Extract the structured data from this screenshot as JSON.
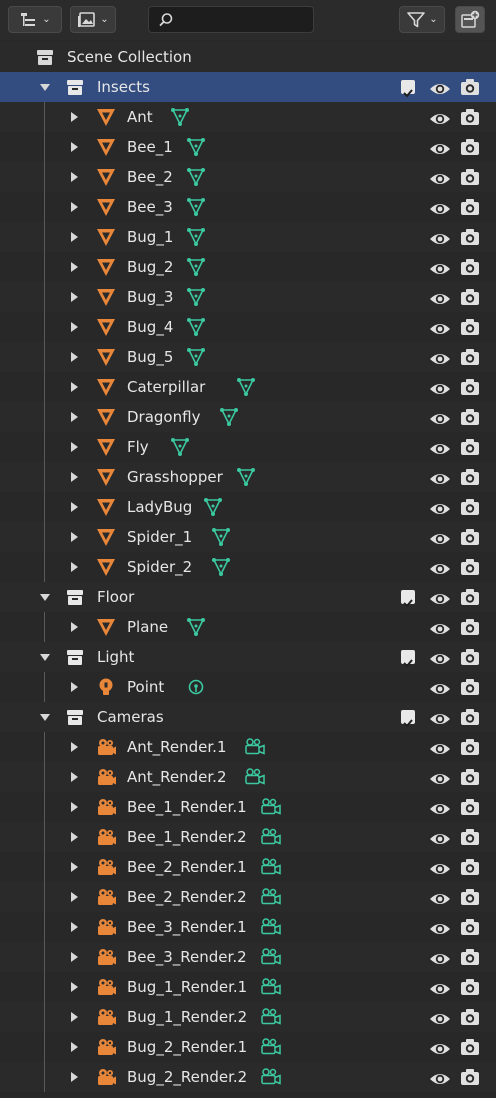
{
  "header": {
    "search_placeholder": "",
    "display_mode_icon": "outliner-view-icon",
    "filter_icon": "funnel-icon",
    "new_collection_icon": "new-collection-icon"
  },
  "colors": {
    "selected_row": "#334d80",
    "object_icon": "#e8873a",
    "data_icon": "#3bc9a0",
    "background": "#282828"
  },
  "tree": {
    "rows": [
      {
        "label": "Scene Collection",
        "type": "scene",
        "depth": 0,
        "expander": "none",
        "checkbox": false,
        "eye": false,
        "camera": false
      },
      {
        "label": "Insects",
        "type": "collection",
        "depth": 1,
        "expander": "down",
        "checkbox": true,
        "eye": true,
        "camera": true,
        "selected": true
      },
      {
        "label": "Ant",
        "type": "mesh",
        "depth": 2,
        "expander": "right",
        "checkbox": false,
        "eye": true,
        "camera": true
      },
      {
        "label": "Bee_1",
        "type": "mesh",
        "depth": 2,
        "expander": "right",
        "checkbox": false,
        "eye": true,
        "camera": true
      },
      {
        "label": "Bee_2",
        "type": "mesh",
        "depth": 2,
        "expander": "right",
        "checkbox": false,
        "eye": true,
        "camera": true
      },
      {
        "label": "Bee_3",
        "type": "mesh",
        "depth": 2,
        "expander": "right",
        "checkbox": false,
        "eye": true,
        "camera": true
      },
      {
        "label": "Bug_1",
        "type": "mesh",
        "depth": 2,
        "expander": "right",
        "checkbox": false,
        "eye": true,
        "camera": true
      },
      {
        "label": "Bug_2",
        "type": "mesh",
        "depth": 2,
        "expander": "right",
        "checkbox": false,
        "eye": true,
        "camera": true
      },
      {
        "label": "Bug_3",
        "type": "mesh",
        "depth": 2,
        "expander": "right",
        "checkbox": false,
        "eye": true,
        "camera": true
      },
      {
        "label": "Bug_4",
        "type": "mesh",
        "depth": 2,
        "expander": "right",
        "checkbox": false,
        "eye": true,
        "camera": true
      },
      {
        "label": "Bug_5",
        "type": "mesh",
        "depth": 2,
        "expander": "right",
        "checkbox": false,
        "eye": true,
        "camera": true
      },
      {
        "label": "Caterpillar",
        "type": "mesh",
        "depth": 2,
        "expander": "right",
        "checkbox": false,
        "eye": true,
        "camera": true
      },
      {
        "label": "Dragonfly",
        "type": "mesh",
        "depth": 2,
        "expander": "right",
        "checkbox": false,
        "eye": true,
        "camera": true
      },
      {
        "label": "Fly",
        "type": "mesh",
        "depth": 2,
        "expander": "right",
        "checkbox": false,
        "eye": true,
        "camera": true
      },
      {
        "label": "Grasshopper",
        "type": "mesh",
        "depth": 2,
        "expander": "right",
        "checkbox": false,
        "eye": true,
        "camera": true
      },
      {
        "label": "LadyBug",
        "type": "mesh",
        "depth": 2,
        "expander": "right",
        "checkbox": false,
        "eye": true,
        "camera": true
      },
      {
        "label": "Spider_1",
        "type": "mesh",
        "depth": 2,
        "expander": "right",
        "checkbox": false,
        "eye": true,
        "camera": true
      },
      {
        "label": "Spider_2",
        "type": "mesh",
        "depth": 2,
        "expander": "right",
        "checkbox": false,
        "eye": true,
        "camera": true
      },
      {
        "label": "Floor",
        "type": "collection",
        "depth": 1,
        "expander": "down",
        "checkbox": true,
        "eye": true,
        "camera": true
      },
      {
        "label": "Plane",
        "type": "mesh",
        "depth": 2,
        "expander": "right",
        "checkbox": false,
        "eye": true,
        "camera": true
      },
      {
        "label": "Light",
        "type": "collection",
        "depth": 1,
        "expander": "down",
        "checkbox": true,
        "eye": true,
        "camera": true
      },
      {
        "label": "Point",
        "type": "light",
        "depth": 2,
        "expander": "right",
        "checkbox": false,
        "eye": true,
        "camera": true
      },
      {
        "label": "Cameras",
        "type": "collection",
        "depth": 1,
        "expander": "down",
        "checkbox": true,
        "eye": true,
        "camera": true
      },
      {
        "label": "Ant_Render.1",
        "type": "camera",
        "depth": 2,
        "expander": "right",
        "checkbox": false,
        "eye": true,
        "camera": true
      },
      {
        "label": "Ant_Render.2",
        "type": "camera",
        "depth": 2,
        "expander": "right",
        "checkbox": false,
        "eye": true,
        "camera": true
      },
      {
        "label": "Bee_1_Render.1",
        "type": "camera",
        "depth": 2,
        "expander": "right",
        "checkbox": false,
        "eye": true,
        "camera": true
      },
      {
        "label": "Bee_1_Render.2",
        "type": "camera",
        "depth": 2,
        "expander": "right",
        "checkbox": false,
        "eye": true,
        "camera": true
      },
      {
        "label": "Bee_2_Render.1",
        "type": "camera",
        "depth": 2,
        "expander": "right",
        "checkbox": false,
        "eye": true,
        "camera": true
      },
      {
        "label": "Bee_2_Render.2",
        "type": "camera",
        "depth": 2,
        "expander": "right",
        "checkbox": false,
        "eye": true,
        "camera": true
      },
      {
        "label": "Bee_3_Render.1",
        "type": "camera",
        "depth": 2,
        "expander": "right",
        "checkbox": false,
        "eye": true,
        "camera": true
      },
      {
        "label": "Bee_3_Render.2",
        "type": "camera",
        "depth": 2,
        "expander": "right",
        "checkbox": false,
        "eye": true,
        "camera": true
      },
      {
        "label": "Bug_1_Render.1",
        "type": "camera",
        "depth": 2,
        "expander": "right",
        "checkbox": false,
        "eye": true,
        "camera": true
      },
      {
        "label": "Bug_1_Render.2",
        "type": "camera",
        "depth": 2,
        "expander": "right",
        "checkbox": false,
        "eye": true,
        "camera": true
      },
      {
        "label": "Bug_2_Render.1",
        "type": "camera",
        "depth": 2,
        "expander": "right",
        "checkbox": false,
        "eye": true,
        "camera": true
      },
      {
        "label": "Bug_2_Render.2",
        "type": "camera",
        "depth": 2,
        "expander": "right",
        "checkbox": false,
        "eye": true,
        "camera": true
      }
    ]
  }
}
